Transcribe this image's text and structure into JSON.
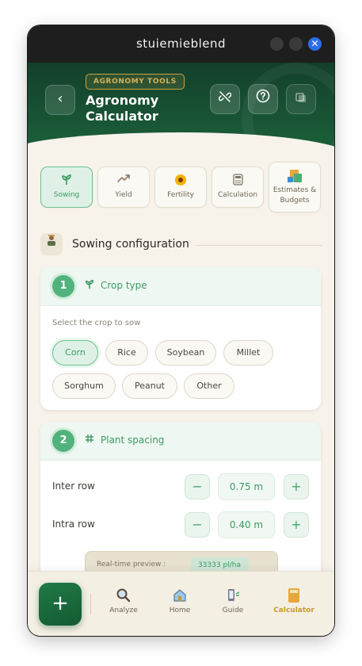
{
  "window": {
    "title": "stuiemieblend",
    "close_glyph": "✕"
  },
  "header": {
    "badge": "AGRONOMY TOOLS",
    "title": "Agronomy Calculator",
    "back_icon": "chevron-left-icon",
    "icons": [
      "link-off-icon",
      "help-circle-icon",
      "translate-icon"
    ]
  },
  "tabs": [
    {
      "label": "Sowing",
      "icon": "sprout-icon",
      "active": true
    },
    {
      "label": "Yield",
      "icon": "trend-up-icon",
      "active": false
    },
    {
      "label": "Fertility",
      "icon": "flower-icon",
      "active": false
    },
    {
      "label": "Calculation",
      "icon": "calculator-icon",
      "active": false
    },
    {
      "label": "Estimates & Budgets",
      "icon": "budget-icon",
      "active": false
    }
  ],
  "section": {
    "title": "Sowing configuration",
    "icon": "farmer-icon"
  },
  "crop_card": {
    "step": "1",
    "title": "Crop type",
    "label": "Select the crop to sow",
    "options": [
      "Corn",
      "Rice",
      "Soybean",
      "Millet",
      "Sorghum",
      "Peanut",
      "Other"
    ],
    "selected": "Corn"
  },
  "spacing_card": {
    "step": "2",
    "title": "Plant spacing",
    "rows": [
      {
        "label": "Inter row",
        "value": "0.75 m"
      },
      {
        "label": "Intra row",
        "value": "0.40 m"
      }
    ],
    "minus": "−",
    "plus": "+"
  },
  "preview": {
    "label": "Real-time preview :",
    "value": "33333 pl/ha"
  },
  "bottom_nav": {
    "fab": "+",
    "items": [
      {
        "label": "Analyze",
        "icon": "magnifier-icon",
        "active": false
      },
      {
        "label": "Home",
        "icon": "home-icon",
        "active": false
      },
      {
        "label": "Guide",
        "icon": "guide-icon",
        "active": false
      },
      {
        "label": "Calculator",
        "icon": "calculator-icon",
        "active": true
      }
    ]
  },
  "colors": {
    "accent": "#52b27d",
    "header": "#1a5a37",
    "active_nav": "#c99a2e"
  }
}
